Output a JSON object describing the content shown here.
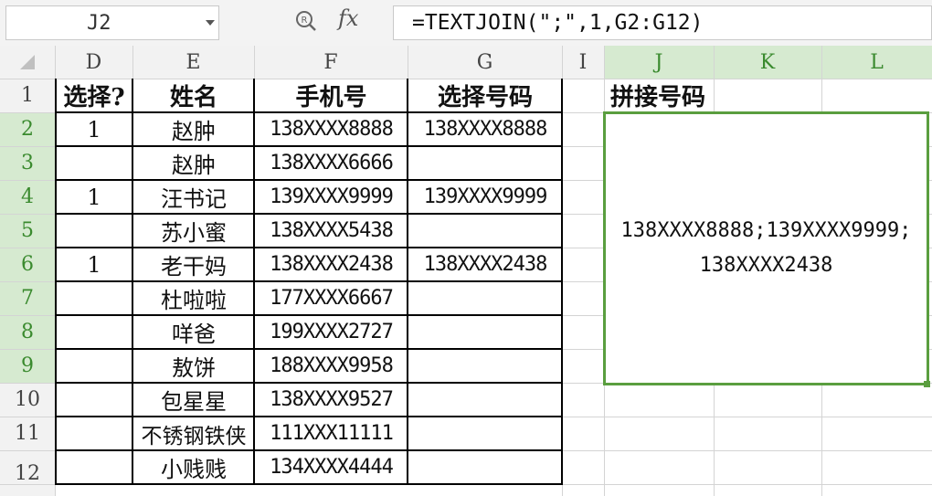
{
  "name_box": {
    "value": "J2"
  },
  "formula_bar": {
    "zoom_icon": "zoom-icon",
    "fx_label": "fx",
    "formula": "=TEXTJOIN(\";\",1,G2:G12)"
  },
  "columns": [
    "D",
    "E",
    "F",
    "G",
    "I",
    "J",
    "K",
    "L"
  ],
  "rows": [
    "1",
    "2",
    "3",
    "4",
    "5",
    "6",
    "7",
    "8",
    "9",
    "10",
    "11",
    "12"
  ],
  "headers": {
    "choose": "选择?",
    "name": "姓名",
    "phone": "手机号",
    "selected": "选择号码",
    "joined": "拼接号码"
  },
  "data": [
    {
      "choose": "1",
      "name": "赵肿",
      "phone": "138XXXX8888",
      "selected": "138XXXX8888"
    },
    {
      "choose": "",
      "name": "赵肿",
      "phone": "138XXXX6666",
      "selected": ""
    },
    {
      "choose": "1",
      "name": "汪书记",
      "phone": "139XXXX9999",
      "selected": "139XXXX9999"
    },
    {
      "choose": "",
      "name": "苏小蜜",
      "phone": "138XXXX5438",
      "selected": ""
    },
    {
      "choose": "1",
      "name": "老干妈",
      "phone": "138XXXX2438",
      "selected": "138XXXX2438"
    },
    {
      "choose": "",
      "name": "杜啦啦",
      "phone": "177XXXX6667",
      "selected": ""
    },
    {
      "choose": "",
      "name": "咩爸",
      "phone": "199XXXX2727",
      "selected": ""
    },
    {
      "choose": "",
      "name": "敖饼",
      "phone": "188XXXX9958",
      "selected": ""
    },
    {
      "choose": "",
      "name": "包星星",
      "phone": "138XXXX9527",
      "selected": ""
    },
    {
      "choose": "",
      "name": "不锈钢铁侠",
      "phone": "111XXX11111",
      "selected": ""
    },
    {
      "choose": "",
      "name": "小贱贱",
      "phone": "134XXXX4444",
      "selected": ""
    }
  ],
  "joined_result": {
    "line1": "138XXXX8888;139XXXX9999;",
    "line2": "138XXXX2438"
  },
  "colors": {
    "selection": "#5a9e3f",
    "header_selected": "#d6ead0"
  }
}
